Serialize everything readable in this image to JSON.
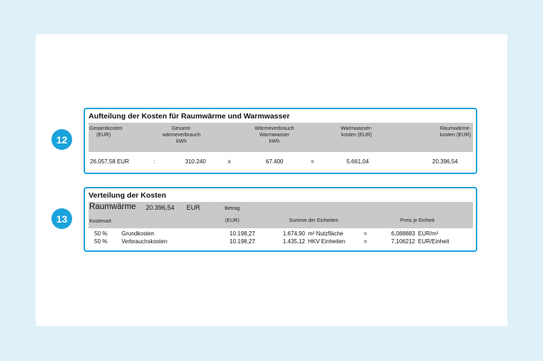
{
  "badges": {
    "first": "12",
    "second": "13"
  },
  "section1": {
    "title": "Aufteilung der Kosten für Raumwärme und Warmwasser",
    "headers": {
      "h1_line1": "Gesamtkosten",
      "h1_line2": "(EUR)",
      "h2_line1": "Gesamt-",
      "h2_line2": "wärmeverbrauch",
      "h2_line3": "kWh",
      "h3_line1": "Wärmeverbrauch",
      "h3_line2": "Warmwasser",
      "h3_line3": "kWh",
      "h4_line1": "Warmwasser-",
      "h4_line2": "kosten (EUR)",
      "h5_line1": "Raumwärme-",
      "h5_line2": "kosten (EUR)"
    },
    "row": {
      "total": "26.057,58 EUR",
      "op1": ":",
      "total_kwh": "310.240",
      "op2": "x",
      "ww_kwh": "67.400",
      "op3": "=",
      "ww_cost": "5.661,04",
      "rw_cost": "20.396,54"
    }
  },
  "section2": {
    "title": "Verteilung der Kosten",
    "raumwaerme_label": "Raumwärme",
    "raumwaerme_value": "20.396,54",
    "raumwaerme_unit": "EUR",
    "betrag_label": "Betrag",
    "betrag_unit": "(EUR)",
    "kostenart_label": "Kostenart",
    "einheiten_label": "Summe der Einheiten",
    "preis_label": "Preis je Einheit",
    "rows": [
      {
        "pct": "50 %",
        "name": "Grundkosten",
        "amount": "10.198,27",
        "colon": ":",
        "units": "1.674,90",
        "unit_name": "m² Nutzfläche",
        "eq": "=",
        "price": "6,088883",
        "price_unit": "EUR/m²"
      },
      {
        "pct": "50 %",
        "name": "Verbrauchskosten",
        "amount": "10.198,27",
        "colon": ":",
        "units": "1.435,12",
        "unit_name": "HKV Einheiten",
        "eq": "=",
        "price": "7,106212",
        "price_unit": "EUR/Einheit"
      }
    ]
  }
}
